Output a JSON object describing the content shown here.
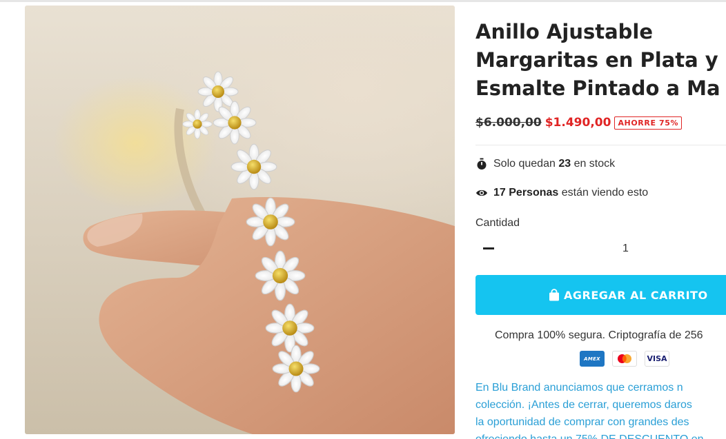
{
  "product": {
    "title": "Anillo Ajustable\nMargaritas en Plata y\nEsmalte Pintado a Ma",
    "image_alt": "Anillo de margaritas"
  },
  "pricing": {
    "old_price": "$6.000,00",
    "new_price": "$1.490,00",
    "save_badge": "AHORRE 75%"
  },
  "stock": {
    "prefix": "Solo quedan",
    "count": "23",
    "suffix": "en stock",
    "icon": "stopwatch-icon"
  },
  "viewers": {
    "count": "17",
    "label": "Personas",
    "suffix": "están viendo esto",
    "icon": "eye-icon"
  },
  "quantity": {
    "label": "Cantidad",
    "value": "1"
  },
  "cart_button": {
    "label": "AGREGAR AL CARRITO",
    "icon": "shopping-bag-icon",
    "color": "#15c4f0"
  },
  "secure": {
    "text": "Compra 100% segura. Criptografía de 256"
  },
  "payment_cards": {
    "amex": "AMEX",
    "visa": "VISA"
  },
  "promo": {
    "text": "  En Blu Brand anunciamos que cerramos n\ncolección. ¡Antes de cerrar, queremos daros\nla oportunidad de comprar con grandes des\nofreciendo hasta un  75% DE DESCUENTO en"
  },
  "colors": {
    "sale": "#e02424",
    "accent": "#15c4f0",
    "promo_text": "#2a9fd6"
  }
}
